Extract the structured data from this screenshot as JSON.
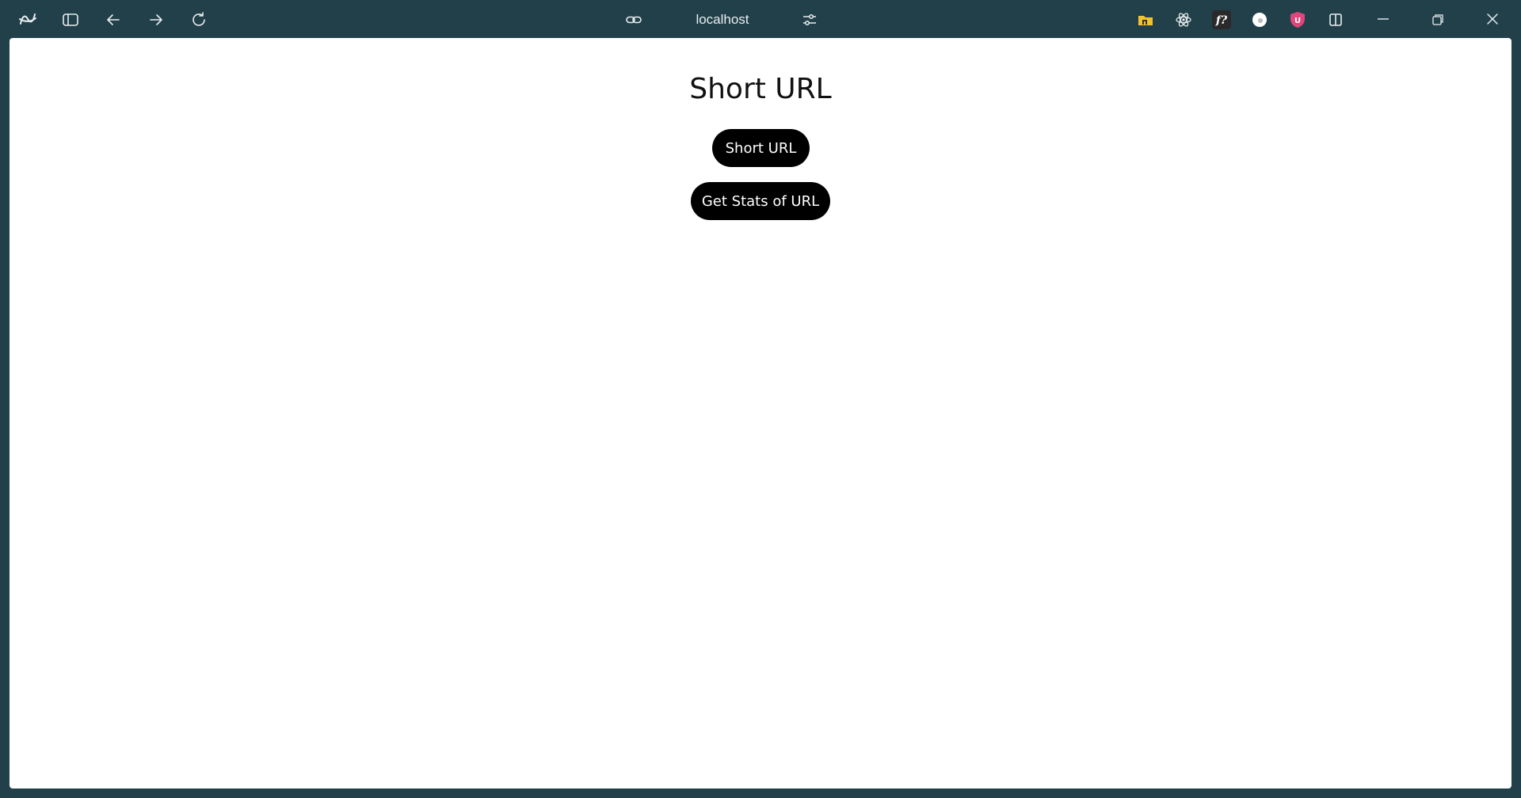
{
  "browser": {
    "address_bar": {
      "url": "localhost"
    },
    "icons": {
      "app_logo": "arc-logo-icon",
      "sidebar_toggle": "sidebar-toggle-icon",
      "back": "arrow-left-icon",
      "forward": "arrow-right-icon",
      "reload": "reload-icon",
      "link": "link-icon",
      "site_settings": "sliders-icon",
      "ext_folder": "folder-extension-icon",
      "ext_react": "react-devtools-icon",
      "ext_fonts": "whatfont-icon",
      "ext_profile": "profile-extension-icon",
      "ext_ublock": "ublock-shield-icon",
      "split_view": "split-view-icon",
      "minimize": "minimize-icon",
      "restore": "restore-icon",
      "close": "close-icon"
    },
    "colors": {
      "frame": "#22404a",
      "ublock": "#e0467c",
      "folder": "#f2c230"
    }
  },
  "page": {
    "title": "Short URL",
    "buttons": {
      "short_url": "Short URL",
      "get_stats": "Get Stats of URL"
    }
  }
}
